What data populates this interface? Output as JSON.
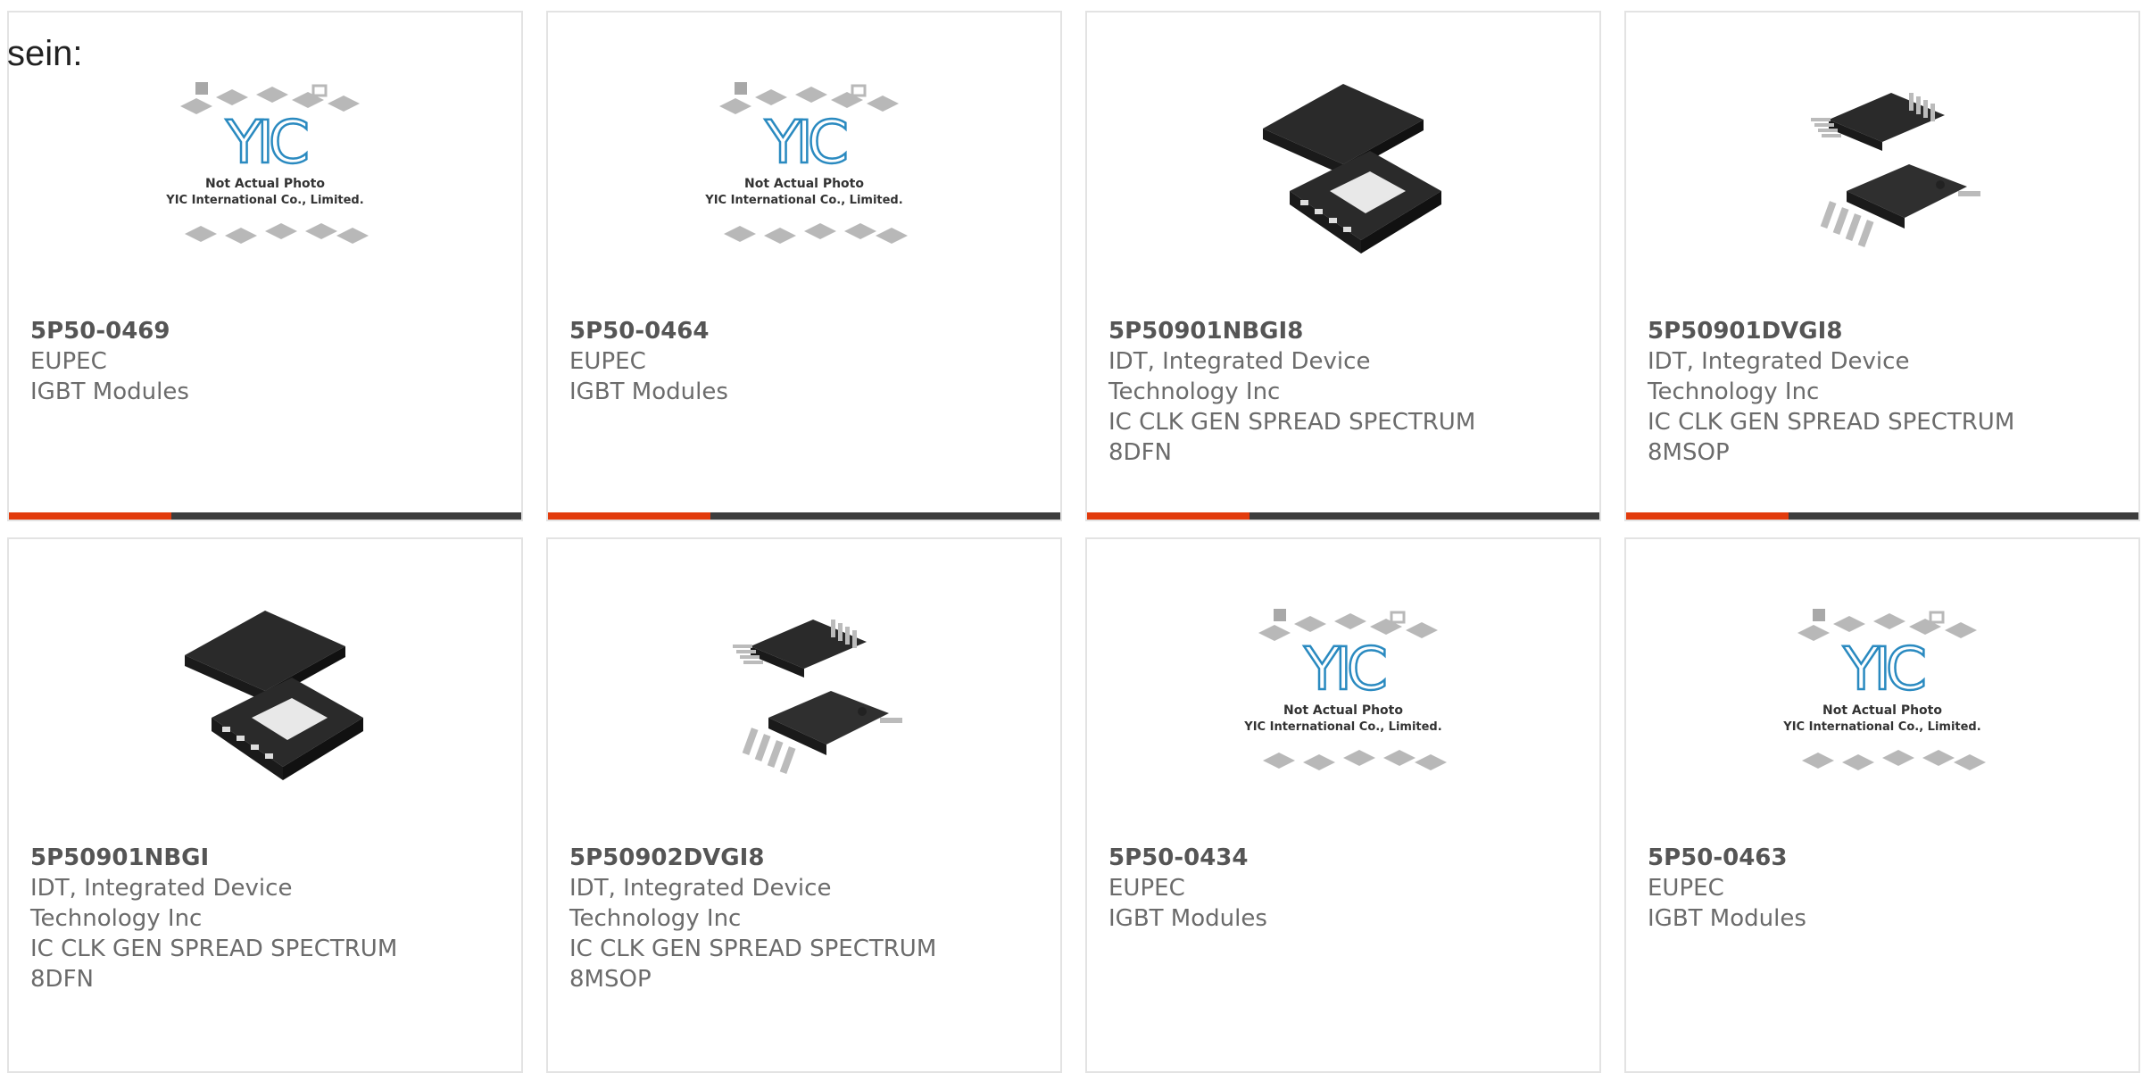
{
  "lead_text": "sein:",
  "colors": {
    "accent": "#e23b0c",
    "bar": "#3d3d3d",
    "border": "#e3e3e3",
    "text": "#6b6b6b"
  },
  "placeholder": {
    "logo": "YIC",
    "line1": "Not Actual Photo",
    "line2": "YIC International Co., Limited."
  },
  "cards": [
    {
      "part": "5P50-0469",
      "maker": [
        "EUPEC"
      ],
      "desc": [
        "IGBT Modules"
      ],
      "image": "placeholder"
    },
    {
      "part": "5P50-0464",
      "maker": [
        "EUPEC"
      ],
      "desc": [
        "IGBT Modules"
      ],
      "image": "placeholder"
    },
    {
      "part": "5P50901NBGI8",
      "maker": [
        "IDT, Integrated Device",
        "Technology Inc"
      ],
      "desc": [
        "IC CLK GEN SPREAD SPECTRUM",
        "8DFN"
      ],
      "image": "dfn"
    },
    {
      "part": "5P50901DVGI8",
      "maker": [
        "IDT, Integrated Device",
        "Technology Inc"
      ],
      "desc": [
        "IC CLK GEN SPREAD SPECTRUM",
        "8MSOP"
      ],
      "image": "msop"
    },
    {
      "part": "5P50901NBGI",
      "maker": [
        "IDT, Integrated Device",
        "Technology Inc"
      ],
      "desc": [
        "IC CLK GEN SPREAD SPECTRUM",
        "8DFN"
      ],
      "image": "dfn"
    },
    {
      "part": "5P50902DVGI8",
      "maker": [
        "IDT, Integrated Device",
        "Technology Inc"
      ],
      "desc": [
        "IC CLK GEN SPREAD SPECTRUM",
        "8MSOP"
      ],
      "image": "msop"
    },
    {
      "part": "5P50-0434",
      "maker": [
        "EUPEC"
      ],
      "desc": [
        "IGBT Modules"
      ],
      "image": "placeholder"
    },
    {
      "part": "5P50-0463",
      "maker": [
        "EUPEC"
      ],
      "desc": [
        "IGBT Modules"
      ],
      "image": "placeholder"
    }
  ]
}
